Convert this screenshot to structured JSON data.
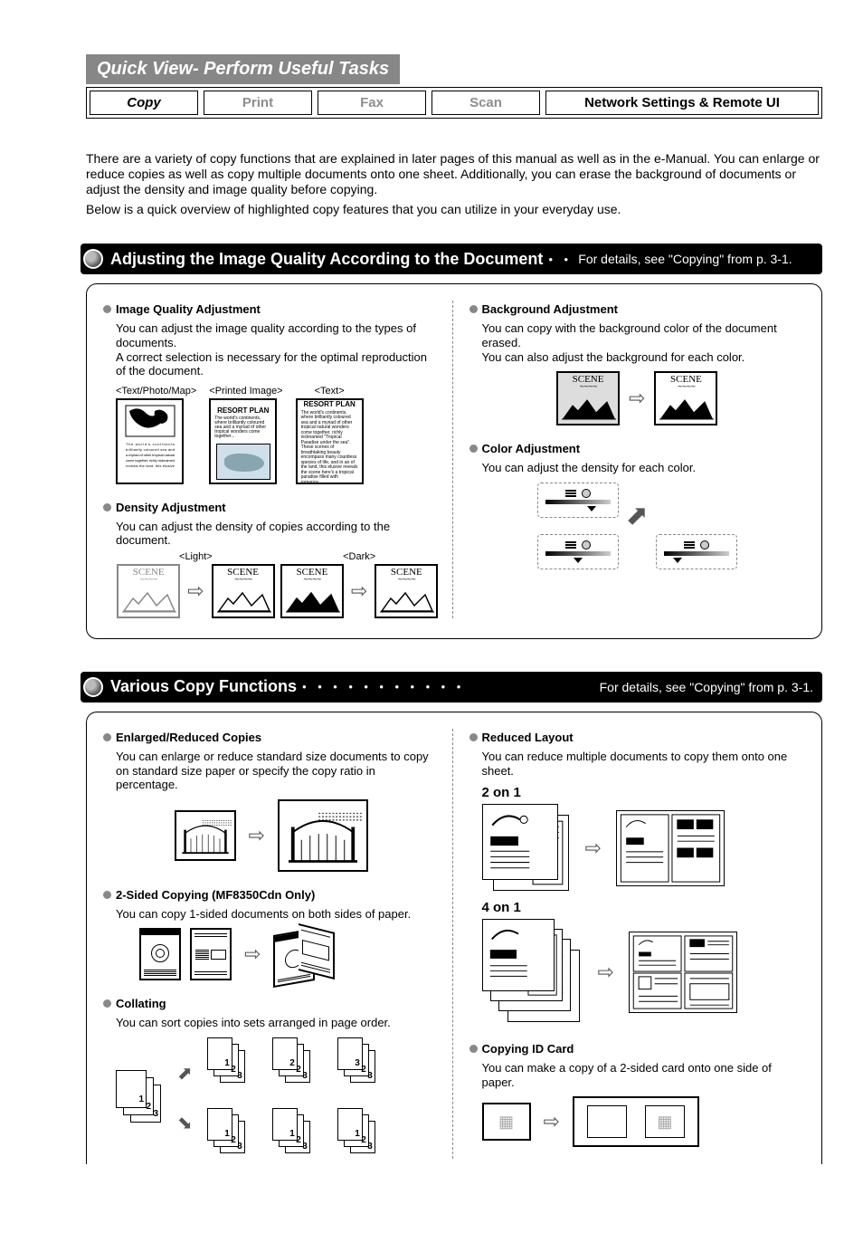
{
  "header": {
    "quick_view": "Quick View- Perform Useful Tasks",
    "tabs": {
      "copy": "Copy",
      "print": "Print",
      "fax": "Fax",
      "scan": "Scan",
      "network": "Network Settings & Remote UI"
    }
  },
  "intro": {
    "p1": "There are a variety of copy functions that are explained in later pages of this manual as well as in the e-Manual.  You can enlarge or reduce copies as well as copy multiple documents onto one sheet.  Additionally, you can erase the background of documents or adjust the density and image quality before copying.",
    "p2": "Below is a quick overview of highlighted copy features that you can utilize in your everyday use."
  },
  "section1": {
    "title": "Adjusting the Image Quality According to the Document",
    "detail": "For details, see \"Copying\" from p. 3-1.",
    "iq_head": "Image Quality Adjustment",
    "iq_body": "You can adjust the image quality according to the types of documents.\nA correct selection is necessary for the optimal reproduction of the document.",
    "thumb1_caption": "<Text/Photo/Map>",
    "thumb2_caption": "<Printed Image>",
    "thumb3_caption": "<Text>",
    "resort_title": "RESORT PLAN",
    "dens_head": "Density Adjustment",
    "dens_body": "You can adjust the density of copies according to the document.",
    "light_caption": "<Light>",
    "dark_caption": "<Dark>",
    "bg_head": "Background Adjustment",
    "bg_body": "You can copy with the background color of the document erased.\nYou can also adjust the background for each color.",
    "color_head": "Color Adjustment",
    "color_body": "You can adjust the density for each color.",
    "scene_label": "SCENE"
  },
  "section2": {
    "title": "Various Copy Functions",
    "detail": "For details, see \"Copying\" from p. 3-1.",
    "enlarge_head": "Enlarged/Reduced Copies",
    "enlarge_body": "You can enlarge or reduce standard size documents to copy on standard size paper or specify the copy ratio in percentage.",
    "two_sided_head": "2-Sided Copying (MF8350Cdn Only)",
    "two_sided_body": "You can copy 1-sided documents on both sides of paper.",
    "collate_head": "Collating",
    "collate_body": "You can sort copies into sets arranged in page order.",
    "reduced_head": "Reduced Layout",
    "reduced_body": "You can reduce multiple documents to copy them onto one sheet.",
    "two_on_one": "2 on 1",
    "four_on_one": "4 on 1",
    "id_head": "Copying ID Card",
    "id_body": "You can make a copy of a 2-sided card onto one side of paper."
  }
}
